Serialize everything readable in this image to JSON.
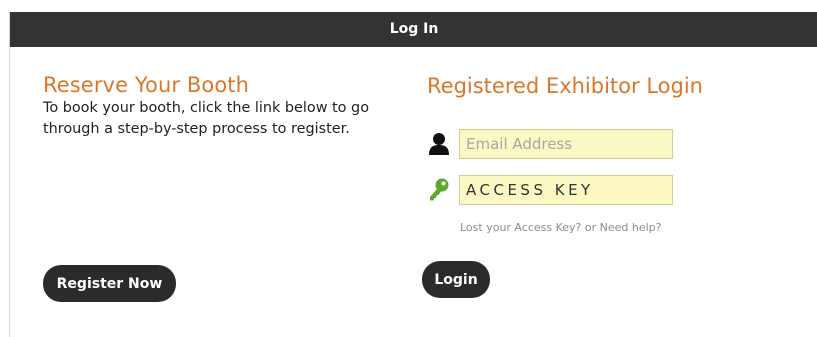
{
  "header": {
    "title": "Log In"
  },
  "left": {
    "title": "Reserve Your Booth",
    "description": "To book your booth, click the link below to go through a step-by-step process to register.",
    "register_label": "Register Now"
  },
  "right": {
    "title": "Registered Exhibitor Login",
    "email": {
      "value": "",
      "placeholder": "Email Address",
      "icon": "user-icon"
    },
    "access_key": {
      "value": "",
      "placeholder": "ACCESS KEY",
      "icon": "key-icon"
    },
    "help_link": "Lost your Access Key? or Need help?",
    "login_label": "Login"
  },
  "colors": {
    "header_bg": "#333333",
    "title_orange": "#d9772a",
    "field_bg": "#fbf8c4",
    "key_icon_green": "#5ea52b",
    "button_bg": "#2b2b2b"
  }
}
